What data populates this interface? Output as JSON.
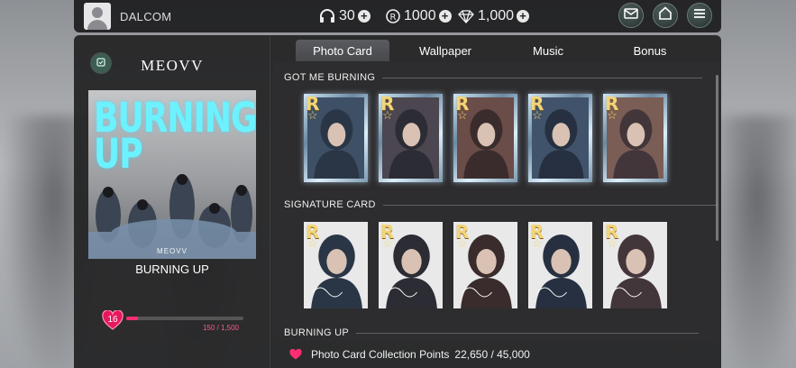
{
  "user": {
    "name": "DALCOM"
  },
  "currencies": {
    "headphones": "30",
    "r_coin": "1000",
    "diamond": "1,000"
  },
  "artist": "MEOVV",
  "album": {
    "cover_text": "BURNING UP",
    "cover_brand": "MEOVV",
    "title": "BURNING UP"
  },
  "level": {
    "value": "16",
    "progress_text": "150 / 1,500",
    "progress": 0.1
  },
  "tabs": [
    "Photo Card",
    "Wallpaper",
    "Music",
    "Bonus"
  ],
  "active_tab": 0,
  "sections": [
    {
      "title": "GOT ME BURNING",
      "cards": [
        {
          "rarity": "R",
          "style": "framed"
        },
        {
          "rarity": "R",
          "style": "framed"
        },
        {
          "rarity": "R",
          "style": "framed"
        },
        {
          "rarity": "R",
          "style": "framed"
        },
        {
          "rarity": "R",
          "style": "framed"
        }
      ]
    },
    {
      "title": "SIGNATURE CARD",
      "cards": [
        {
          "rarity": "R",
          "style": "plain"
        },
        {
          "rarity": "R",
          "style": "plain"
        },
        {
          "rarity": "R",
          "style": "plain"
        },
        {
          "rarity": "R",
          "style": "plain"
        },
        {
          "rarity": "R",
          "style": "plain"
        }
      ]
    },
    {
      "title": "BURNING UP",
      "cards": []
    }
  ],
  "footer": {
    "label": "Photo Card Collection Points",
    "value": "22,650 / 45,000"
  },
  "colors": {
    "accent_pink": "#ff2d72",
    "cover_cyan": "#6cf2ff",
    "rarity_gold": "#f2d47a"
  },
  "icons": [
    "headphones-icon",
    "r-coin-icon",
    "diamond-icon",
    "mail-icon",
    "home-icon",
    "menu-icon",
    "back-icon",
    "heart-icon"
  ]
}
